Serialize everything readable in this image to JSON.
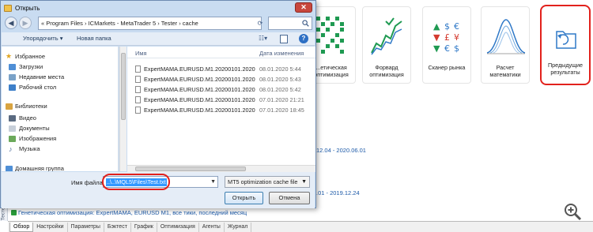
{
  "dialog": {
    "title": "Открыть",
    "close_label": "✕",
    "address": "« Program Files › ICMarkets - MetaTrader 5 › Tester › cache",
    "toolbar": {
      "organize": "Упорядочить ▾",
      "new_folder": "Новая папка",
      "help": "?"
    },
    "nav": {
      "favorites": "Избранное",
      "downloads": "Загрузки",
      "recent": "Недавние места",
      "desktop": "Рабочий стол",
      "libraries": "Библиотеки",
      "video": "Видео",
      "documents": "Документы",
      "images": "Изображения",
      "music": "Музыка",
      "homegroup": "Домашняя группа"
    },
    "columns": {
      "name": "Имя",
      "date": "Дата изменения"
    },
    "files": [
      {
        "name": "ExpertMAMA.EURUSD.M1.20200101.20200...",
        "date": "08.01.2020 5:44"
      },
      {
        "name": "ExpertMAMA.EURUSD.M1.20200101.20200...",
        "date": "08.01.2020 5:43"
      },
      {
        "name": "ExpertMAMA.EURUSD.M1.20200101.20200...",
        "date": "08.01.2020 5:42"
      },
      {
        "name": "ExpertMAMA.EURUSD.M1.20200101.20200...",
        "date": "07.01.2020 21:21"
      },
      {
        "name": "ExpertMAMA.EURUSD.M1.20200101.20200...",
        "date": "07.01.2020 18:45"
      }
    ],
    "filename_label": "Имя файла:",
    "filename_value": "..\\..\\MQL5\\Files\\Test.txt",
    "filetype": "MT5 optimization cache file",
    "open_button": "Открыть",
    "cancel_button": "Отмена"
  },
  "tiles": [
    {
      "label": "...етическая\nоптимизация"
    },
    {
      "label": "Форвард\nоптимизация"
    },
    {
      "label": "Сканер рынка"
    },
    {
      "label": "Расчет\nматематики"
    },
    {
      "label": "Предыдущие\nрезультаты"
    }
  ],
  "background_text": {
    "range1": "12.04 - 2020.06.01",
    "range2": ".01 - 2019.12.24",
    "status": "Генетическая оптимизация: ExpertMAMA, EURUSD M1, все тики, последний месяц"
  },
  "side_label": "Тестер стратегий",
  "bottom_tabs": [
    "Обзор",
    "Настройки",
    "Параметры",
    "Бэктест",
    "График",
    "Оптимизация",
    "Агенты",
    "Журнал"
  ],
  "colors": {
    "accent": "#1d5aa8",
    "highlight_red": "#e2211c",
    "dialog_frame": "#c9dcf1",
    "selection": "#3399ff"
  }
}
